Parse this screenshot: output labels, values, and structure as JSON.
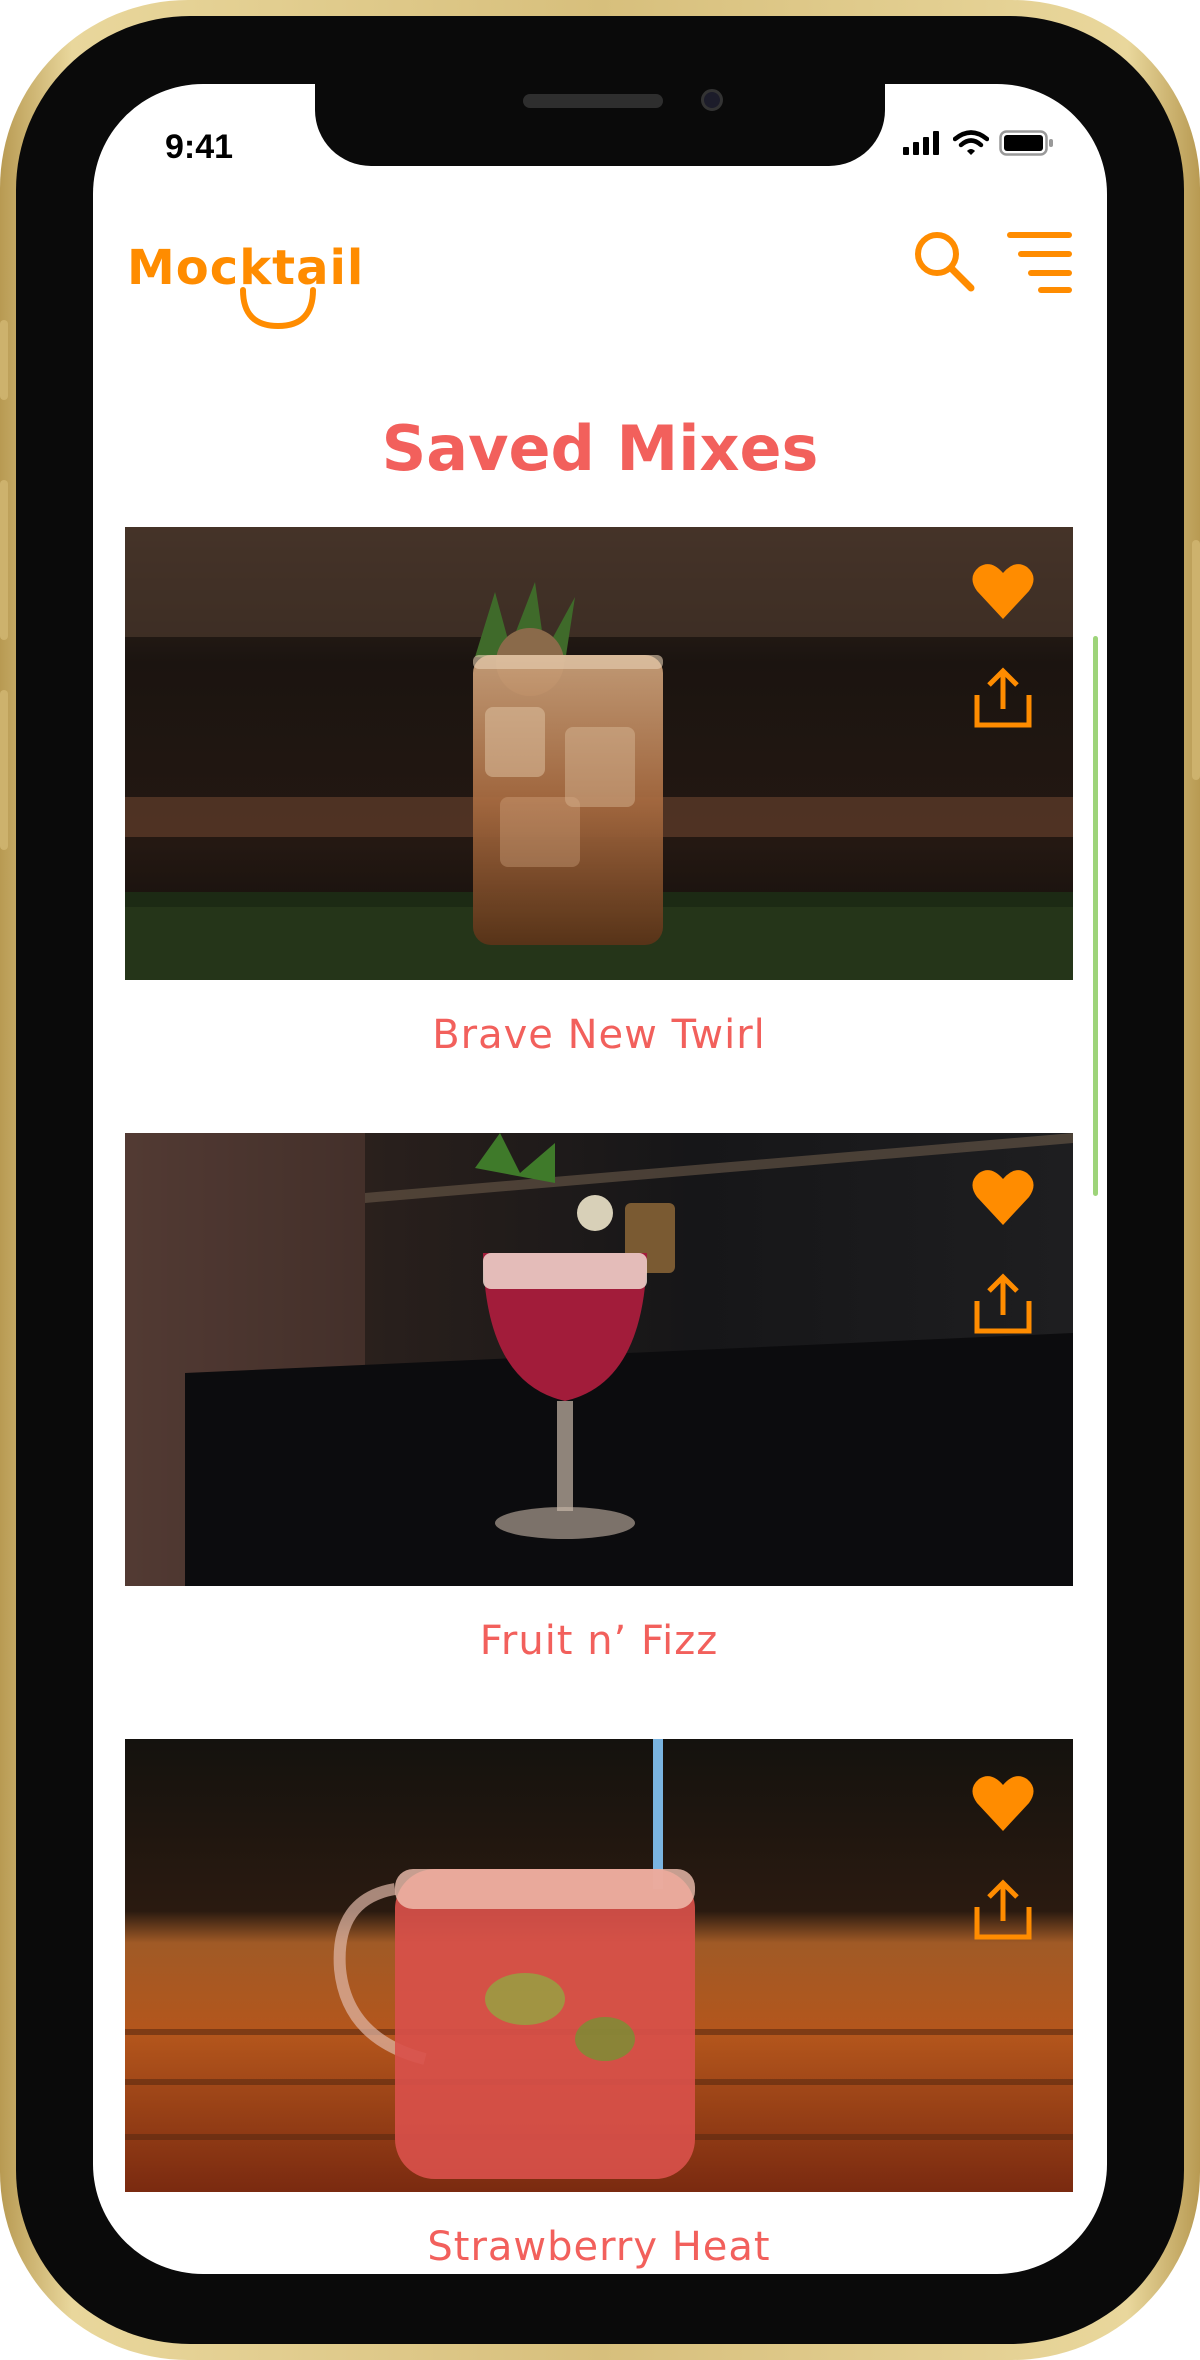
{
  "status_bar": {
    "time": "9:41"
  },
  "header": {
    "logo_text": "Mocktail",
    "icons": [
      "search-icon",
      "menu-icon"
    ]
  },
  "page": {
    "title": "Saved Mixes"
  },
  "cards": [
    {
      "name": "Brave New Twirl",
      "favorited": true,
      "actions": [
        "heart-icon",
        "share-icon"
      ]
    },
    {
      "name": "Fruit n’ Fizz",
      "favorited": true,
      "actions": [
        "heart-icon",
        "share-icon"
      ]
    },
    {
      "name": "Strawberry Heat",
      "favorited": true,
      "actions": [
        "heart-icon",
        "share-icon"
      ]
    }
  ],
  "colors": {
    "brand_orange": "#ff8c00",
    "title_coral": "#f2605c",
    "scrollbar_green": "#9ed47a",
    "device_gold": "#d7bf7c"
  }
}
